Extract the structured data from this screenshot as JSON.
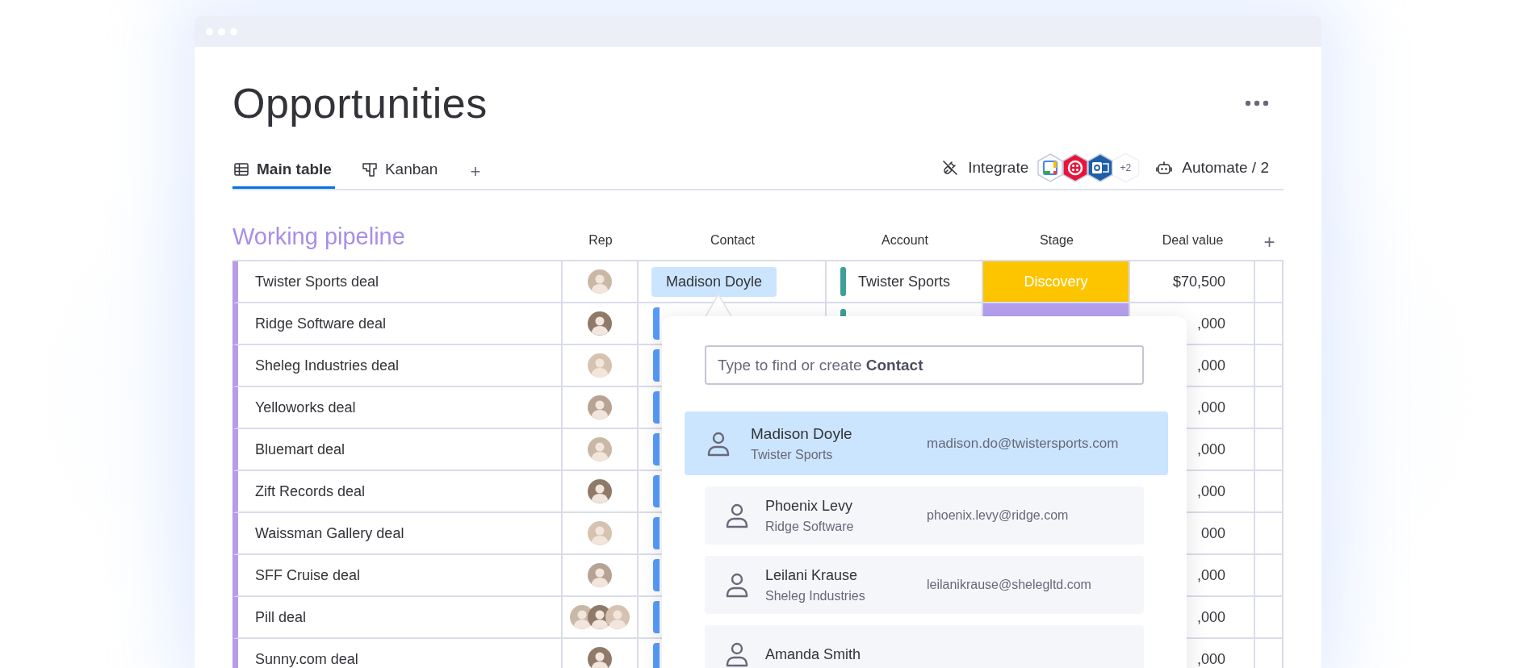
{
  "window": {
    "title": "Opportunities"
  },
  "tabs": [
    {
      "label": "Main table",
      "kind": "table",
      "selected": true
    },
    {
      "label": "Kanban",
      "kind": "kanban",
      "selected": false
    }
  ],
  "add_tab": "+",
  "toolbar": {
    "integrate": "Integrate",
    "integrations": [
      {
        "kind": "calendar"
      },
      {
        "kind": "grid"
      },
      {
        "kind": "mail"
      }
    ],
    "more_integrations": "+2",
    "automate": "Automate / 2"
  },
  "group": {
    "title": "Working pipeline",
    "columns": [
      "Rep",
      "Contact",
      "Account",
      "Stage",
      "Deal value"
    ],
    "add_column": "+"
  },
  "rows": [
    {
      "name": "Twister Sports deal",
      "reps": [
        {
          "kind": "avatar"
        }
      ],
      "contact": {
        "kind": "chip",
        "label": "Madison Doyle"
      },
      "account": {
        "label": "Twister Sports",
        "color": "#3d9f97"
      },
      "stage": {
        "label": "Discovery",
        "color": "#fdc500"
      },
      "deal_value": "$70,500"
    },
    {
      "name": "Ridge Software deal",
      "reps": [
        {
          "kind": "avatar"
        }
      ],
      "contact": {
        "kind": "bar"
      },
      "account": {
        "color": "#3d9f97"
      },
      "stage": {
        "color": "#b5a0ef"
      },
      "deal_value": ",000"
    },
    {
      "name": "Sheleg Industries deal",
      "reps": [
        {
          "kind": "avatar"
        }
      ],
      "contact": {
        "kind": "bar"
      },
      "deal_value": ",000"
    },
    {
      "name": "Yelloworks deal",
      "reps": [
        {
          "kind": "avatar"
        }
      ],
      "contact": {
        "kind": "bar"
      },
      "deal_value": ",000"
    },
    {
      "name": "Bluemart deal",
      "reps": [
        {
          "kind": "avatar"
        }
      ],
      "contact": {
        "kind": "bar"
      },
      "deal_value": ",000"
    },
    {
      "name": "Zift Records deal",
      "reps": [
        {
          "kind": "avatar"
        }
      ],
      "contact": {
        "kind": "bar"
      },
      "deal_value": ",000"
    },
    {
      "name": "Waissman Gallery deal",
      "reps": [
        {
          "kind": "avatar"
        }
      ],
      "contact": {
        "kind": "bar"
      },
      "deal_value": "000"
    },
    {
      "name": "SFF Cruise deal",
      "reps": [
        {
          "kind": "avatar"
        }
      ],
      "contact": {
        "kind": "bar"
      },
      "deal_value": ",000"
    },
    {
      "name": "Pill deal",
      "reps": [
        {
          "kind": "avatar"
        },
        {
          "kind": "avatar"
        },
        {
          "kind": "avatar"
        }
      ],
      "contact": {
        "kind": "bar"
      },
      "deal_value": ",000"
    },
    {
      "name": "Sunny.com deal",
      "reps": [
        {
          "kind": "avatar"
        }
      ],
      "contact": {
        "kind": "bar"
      },
      "deal_value": ",000"
    }
  ],
  "contact_picker": {
    "placeholder": "Type to find or create **Contact**",
    "options": [
      {
        "name": "Madison Doyle",
        "company": "Twister Sports",
        "email": "madison.do@twistersports.com",
        "selected": true
      },
      {
        "name": "Phoenix Levy",
        "company": "Ridge Software",
        "email": "phoenix.levy@ridge.com",
        "selected": false
      },
      {
        "name": "Leilani Krause",
        "company": "Sheleg Industries",
        "email": "leilanikrause@shelegltd.com",
        "selected": false
      },
      {
        "name": "Amanda Smith",
        "selected": false
      }
    ]
  }
}
